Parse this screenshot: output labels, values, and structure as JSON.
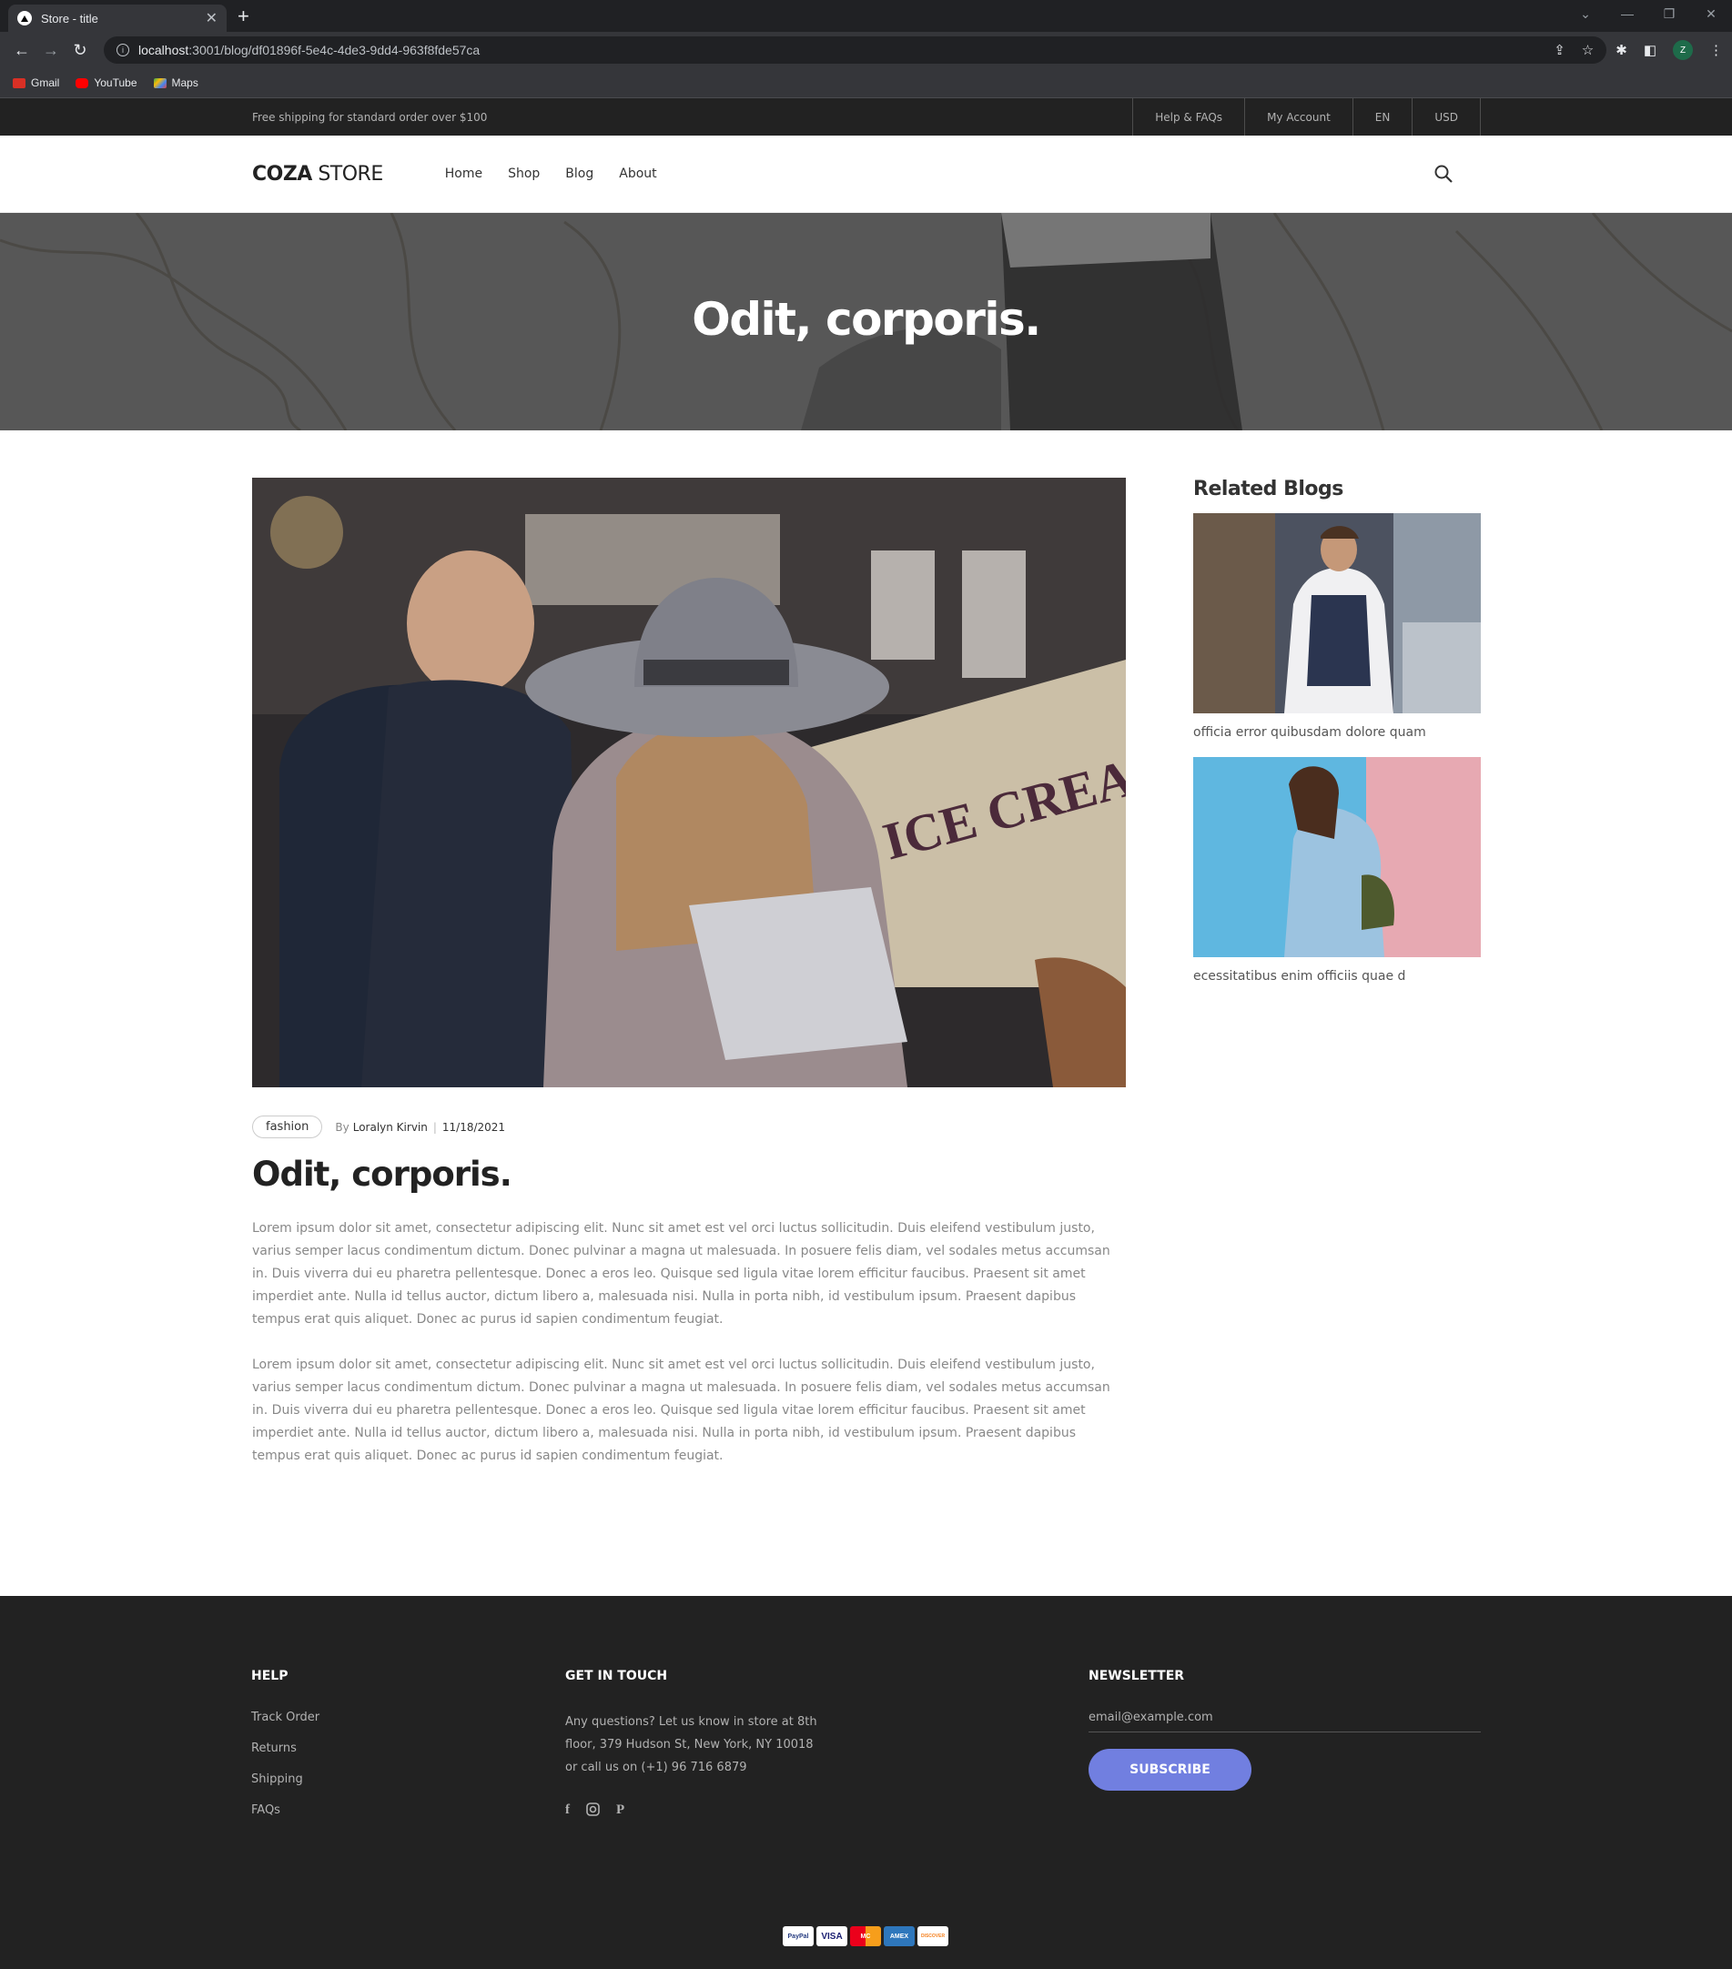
{
  "browser": {
    "tab_title": "Store - title",
    "url_host": "localhost",
    "url_path": ":3001/blog/df01896f-5e4c-4de3-9dd4-963f8fde57ca",
    "profile_initial": "Z",
    "bookmarks": [
      {
        "label": "Gmail",
        "icon": "gmail-icon",
        "color": "#d93025"
      },
      {
        "label": "YouTube",
        "icon": "youtube-icon",
        "color": "#ff0000"
      },
      {
        "label": "Maps",
        "icon": "maps-icon",
        "color": "#34a853"
      }
    ]
  },
  "topbar": {
    "shipping_note": "Free shipping for standard order over $100",
    "links": [
      "Help & FAQs",
      "My Account",
      "EN",
      "USD"
    ]
  },
  "header": {
    "logo_bold": "COZA",
    "logo_light": " STORE",
    "menu": [
      "Home",
      "Shop",
      "Blog",
      "About"
    ]
  },
  "hero": {
    "title": "Odit, corporis."
  },
  "article": {
    "tag": "fashion",
    "by": "By",
    "author": "Loralyn Kirvin",
    "separator": "|",
    "date": "11/18/2021",
    "title": "Odit, corporis.",
    "paragraphs": [
      "Lorem ipsum dolor sit amet, consectetur adipiscing elit. Nunc sit amet est vel orci luctus sollicitudin. Duis eleifend vestibulum justo, varius semper lacus condimentum dictum. Donec pulvinar a magna ut malesuada. In posuere felis diam, vel sodales metus accumsan in. Duis viverra dui eu pharetra pellentesque. Donec a eros leo. Quisque sed ligula vitae lorem efficitur faucibus. Praesent sit amet imperdiet ante. Nulla id tellus auctor, dictum libero a, malesuada nisi. Nulla in porta nibh, id vestibulum ipsum. Praesent dapibus tempus erat quis aliquet. Donec ac purus id sapien condimentum feugiat.",
      "Lorem ipsum dolor sit amet, consectetur adipiscing elit. Nunc sit amet est vel orci luctus sollicitudin. Duis eleifend vestibulum justo, varius semper lacus condimentum dictum. Donec pulvinar a magna ut malesuada. In posuere felis diam, vel sodales metus accumsan in. Duis viverra dui eu pharetra pellentesque. Donec a eros leo. Quisque sed ligula vitae lorem efficitur faucibus. Praesent sit amet imperdiet ante. Nulla id tellus auctor, dictum libero a, malesuada nisi. Nulla in porta nibh, id vestibulum ipsum. Praesent dapibus tempus erat quis aliquet. Donec ac purus id sapien condimentum feugiat."
    ]
  },
  "sidebar": {
    "heading": "Related Blogs",
    "items": [
      {
        "caption": "officia error quibusdam dolore quam"
      },
      {
        "caption": "ecessitatibus enim officiis quae d"
      }
    ]
  },
  "footer": {
    "help_heading": "HELP",
    "help_links": [
      "Track Order",
      "Returns",
      "Shipping",
      "FAQs"
    ],
    "touch_heading": "GET IN TOUCH",
    "touch_text": "Any questions? Let us know in store at 8th floor, 379 Hudson St, New York, NY 10018 or call us on (+1) 96 716 6879",
    "socials": [
      "facebook-icon",
      "instagram-icon",
      "pinterest-icon"
    ],
    "newsletter_heading": "NEWSLETTER",
    "email_placeholder": "email@example.com",
    "subscribe_label": "SUBSCRIBE",
    "payments": [
      "PayPal",
      "VISA",
      "MC",
      "AMEX",
      "DISCOVER"
    ]
  },
  "colors": {
    "accent": "#717fe0",
    "topbar_bg": "#222222",
    "footer_bg": "#222222",
    "text_dark": "#222222",
    "text_muted": "#888888"
  }
}
